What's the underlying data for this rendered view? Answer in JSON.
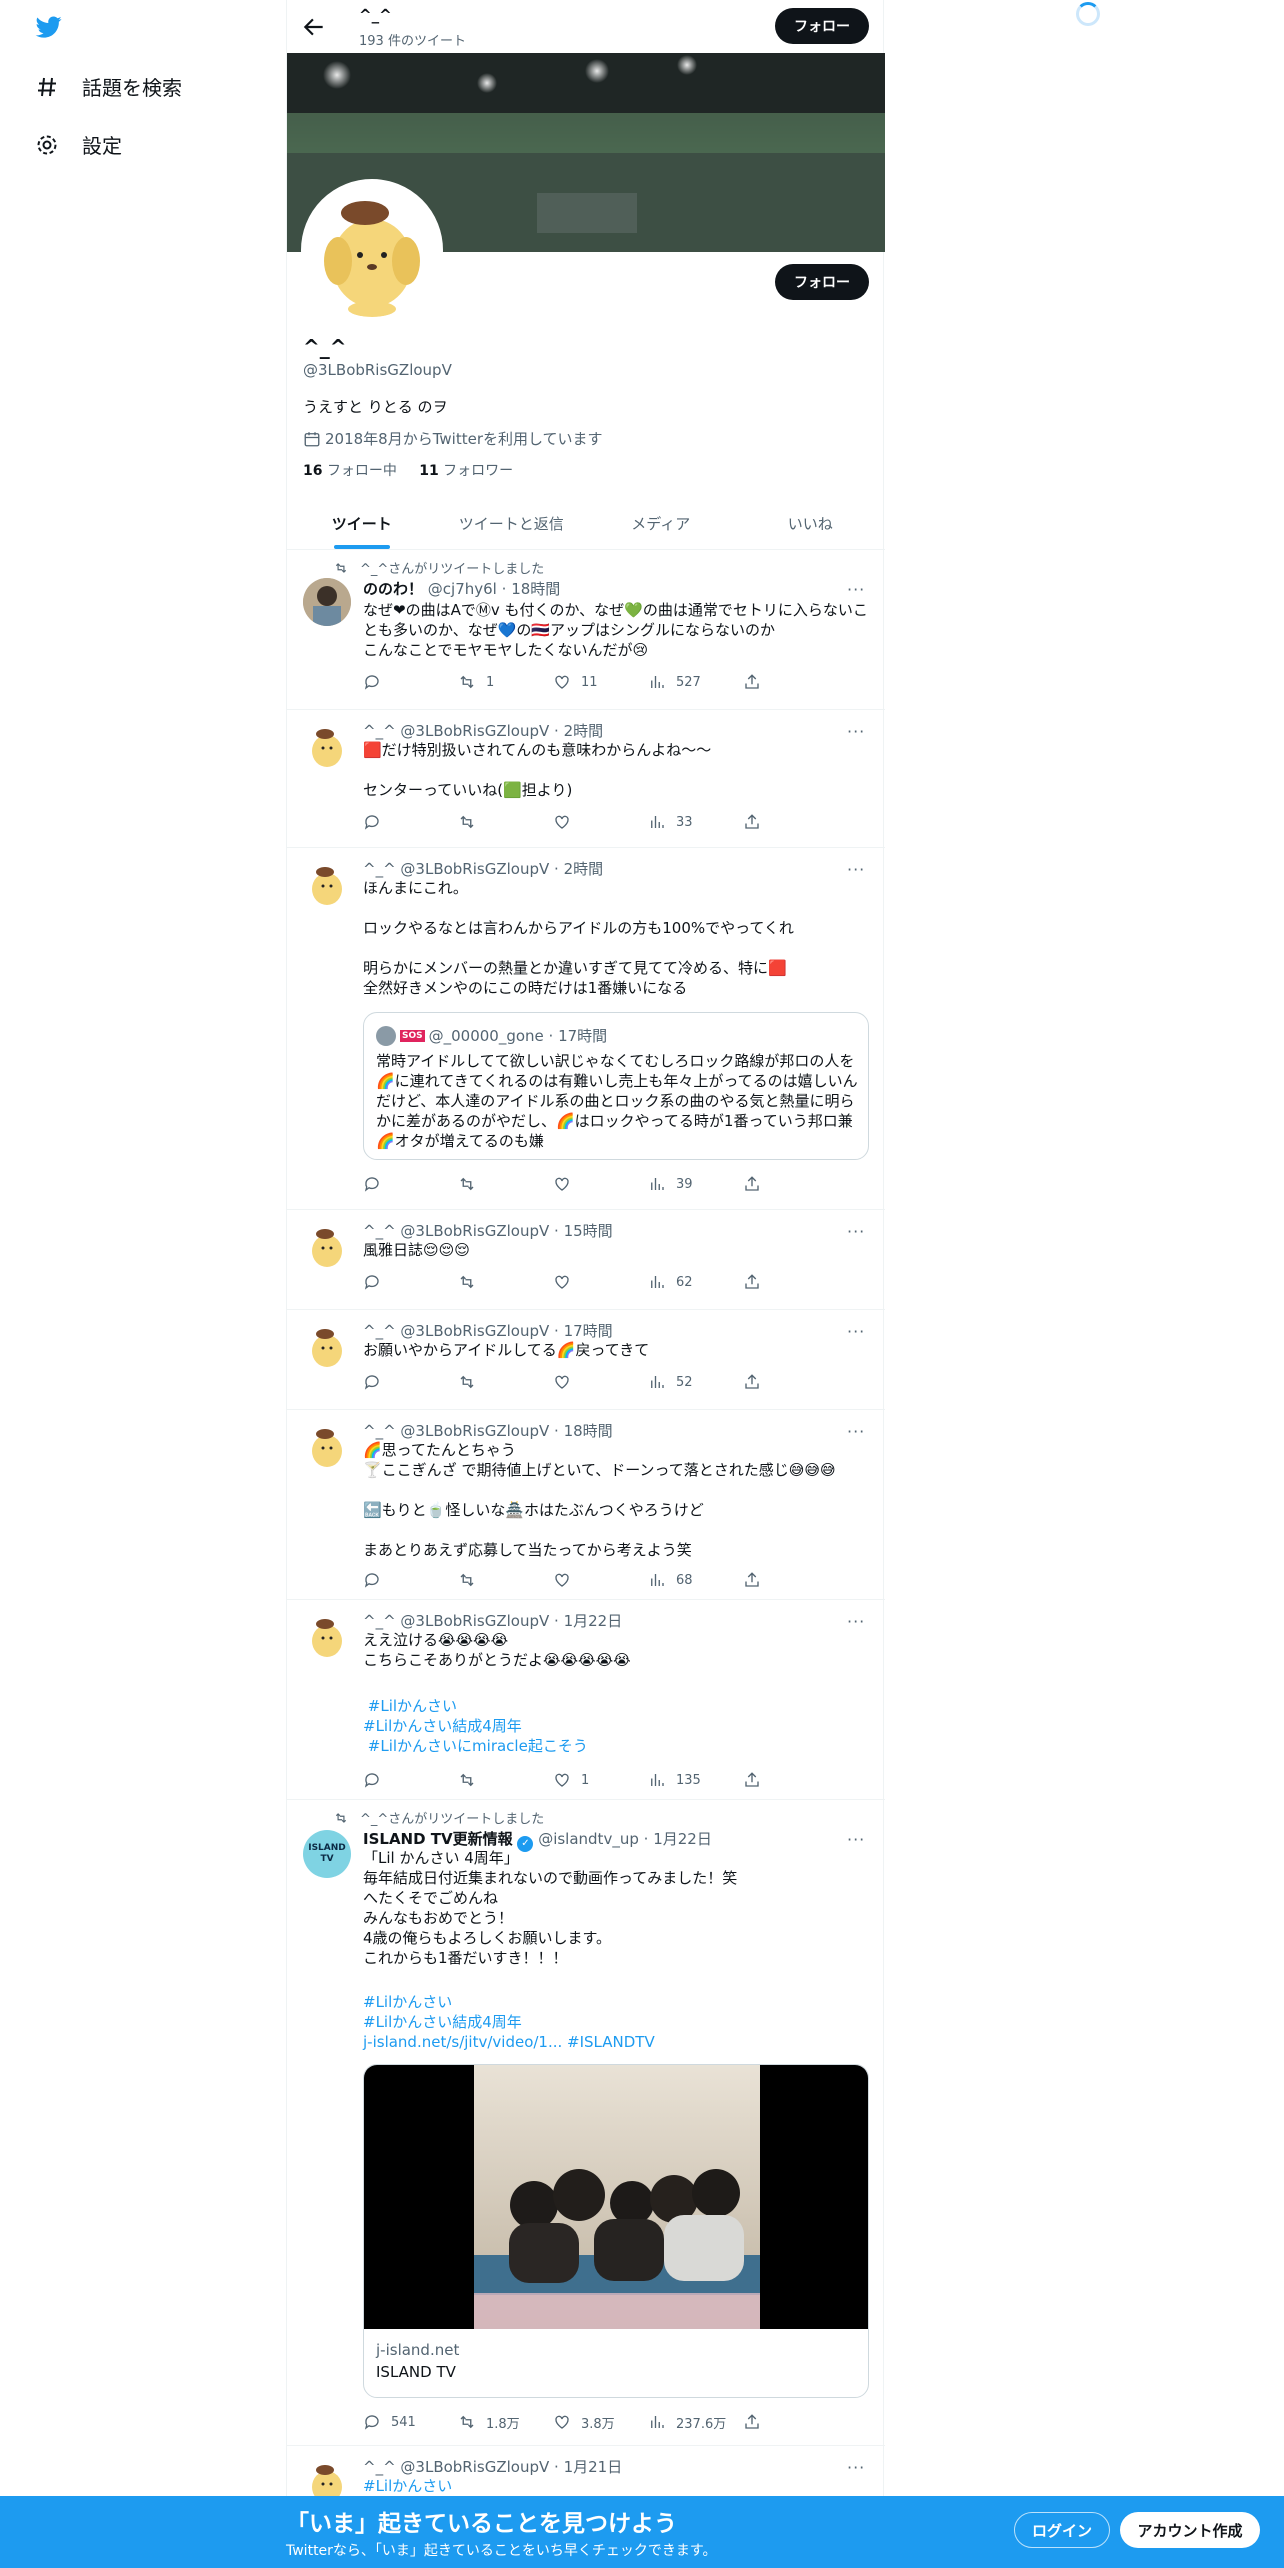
{
  "nav": {
    "explore_label": "話題を検索",
    "settings_label": "設定"
  },
  "header": {
    "name": "^_^",
    "tweet_count": "193 件のツイート",
    "follow_label": "フォロー"
  },
  "profile": {
    "name": "^_^",
    "handle": "@3LBobRisGZloupV",
    "bio": "うえすと りとる のヲ",
    "joined": "2018年8月からTwitterを利用しています",
    "following_count": "16",
    "following_label": "フォロー中",
    "followers_count": "11",
    "followers_label": "フォロワー",
    "follow_label": "フォロー"
  },
  "tabs": [
    {
      "label": "ツイート"
    },
    {
      "label": "ツイートと返信"
    },
    {
      "label": "メディア"
    },
    {
      "label": "いいね"
    }
  ],
  "tweets": [
    {
      "retweet_label": "^_^さんがリツイートしました",
      "name": "ののわ！",
      "handle": "@cj7hy6l",
      "time": "18時間",
      "text": "なぜ❤の曲はAでⓂv も付くのか、なぜ💚の曲は通常でセトリに入らないことも多いのか、なぜ💙の🇹🇭アップはシングルにならないのか\nこんなことでモヤモヤしたくないんだが😢",
      "reply": "",
      "retweet": "1",
      "like": "11",
      "views": "527"
    },
    {
      "name": "^_^",
      "handle": "@3LBobRisGZloupV",
      "time": "2時間",
      "text": "🟥だけ特別扱いされてんのも意味わからんよね〜〜\n\nセンターっていいね(🟩担より)",
      "reply": "",
      "retweet": "",
      "like": "",
      "views": "33"
    },
    {
      "name": "^_^",
      "handle": "@3LBobRisGZloupV",
      "time": "2時間",
      "text": "ほんまにこれ。\n\nロックやるなとは言わんからアイドルの方も100%でやってくれ\n\n明らかにメンバーの熱量とか違いすぎて見てて冷める、特に🟥\n全然好きメンやのにこの時だけは1番嫌いになる",
      "quote": {
        "badge": "SOS",
        "handle": "@_00000_gone",
        "time": "17時間",
        "text": "常時アイドルしてて欲しい訳じゃなくてむしろロック路線が邦ロの人を🌈に連れてきてくれるのは有難いし売上も年々上がってるのは嬉しいんだけど、本人達のアイドル系の曲とロック系の曲のやる気と熱量に明らかに差があるのがやだし、🌈はロックやってる時が1番っていう邦ロ兼🌈オタが増えてるのも嫌"
      },
      "reply": "",
      "retweet": "",
      "like": "",
      "views": "39"
    },
    {
      "name": "^_^",
      "handle": "@3LBobRisGZloupV",
      "time": "15時間",
      "text": "風雅日誌😌😌😌",
      "reply": "",
      "retweet": "",
      "like": "",
      "views": "62"
    },
    {
      "name": "^_^",
      "handle": "@3LBobRisGZloupV",
      "time": "17時間",
      "text": "お願いやからアイドルしてる🌈戻ってきて",
      "reply": "",
      "retweet": "",
      "like": "",
      "views": "52"
    },
    {
      "name": "^_^",
      "handle": "@3LBobRisGZloupV",
      "time": "18時間",
      "text": "🌈思ってたんとちゃう\n🍸ここぎんざ で期待値上げといて、ドーンって落とされた感じ😅😅😅\n\n🔙もりと🍵怪しいな🏯ホはたぶんつくやろうけど\n\nまあとりあえず応募して当たってから考えよう笑",
      "reply": "",
      "retweet": "",
      "like": "",
      "views": "68"
    },
    {
      "name": "^_^",
      "handle": "@3LBobRisGZloupV",
      "time": "1月22日",
      "text": "ええ泣ける😭😭😭😭\nこちらこそありがとうだよ😭😭😭😭😭",
      "hashtags": [
        " #Lilかんさい",
        "#Lilかんさい結成4周年",
        " #Lilかんさいにmiracle起こそう"
      ],
      "reply": "",
      "retweet": "",
      "like": "1",
      "views": "135"
    },
    {
      "retweet_label": "^_^さんがリツイートしました",
      "name": "ISLAND TV更新情報",
      "handle": "@islandtv_up",
      "time": "1月22日",
      "avatar_label": "ISLAND TV",
      "text": "「Lil かんさい 4周年」\n毎年結成日付近集まれないので動画作ってみました！笑\nへたくそでごめんね\nみんなもおめでとう！\n4歳の俺らもよろしくお願いします。\nこれからも1番だいすき！！！",
      "hashtags": [
        "#Lilかんさい",
        "#Lilかんさい結成4周年",
        "j-island.net/s/jitv/video/1... #ISLANDTV"
      ],
      "card": {
        "domain": "j-island.net",
        "title": "ISLAND TV"
      },
      "reply": "541",
      "retweet": "1.8万",
      "like": "3.8万",
      "views": "237.6万"
    },
    {
      "name": "^_^",
      "handle": "@3LBobRisGZloupV",
      "time": "1月21日",
      "text": "#Lilかんさい"
    }
  ],
  "bottom_bar": {
    "title": "「いま」起きていることを見つけよう",
    "subtitle": "Twitterなら、「いま」起きていることをいち早くチェックできます。",
    "login_label": "ログイン",
    "signup_label": "アカウント作成"
  },
  "colors": {
    "accent": "#1d9bf0",
    "text_primary": "#0f1419",
    "text_secondary": "#536471"
  }
}
